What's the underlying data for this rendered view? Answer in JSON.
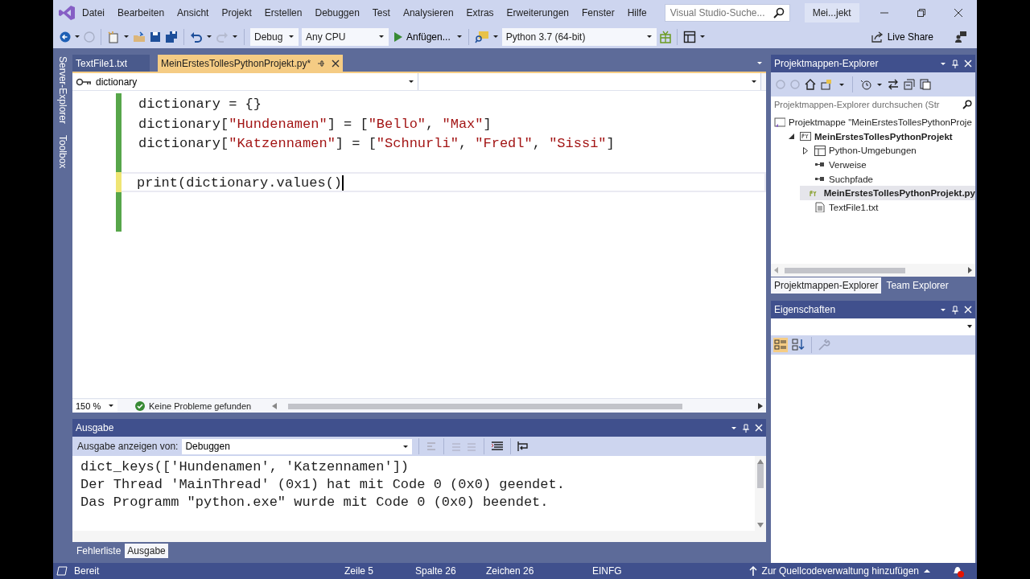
{
  "window": {
    "title": "Mei...jekt",
    "search_placeholder": "Visual Studio-Suche..."
  },
  "menu": [
    "Datei",
    "Bearbeiten",
    "Ansicht",
    "Projekt",
    "Erstellen",
    "Debuggen",
    "Test",
    "Analysieren",
    "Extras",
    "Erweiterungen",
    "Fenster",
    "Hilfe"
  ],
  "toolbar": {
    "configuration": "Debug",
    "platform": "Any CPU",
    "start": "Anfügen...",
    "environment": "Python 3.7 (64-bit)",
    "live_share": "Live Share"
  },
  "side_tabs": [
    "Server-Explorer",
    "Toolbox"
  ],
  "editor": {
    "tabs": [
      {
        "label": "TextFile1.txt",
        "selected": false
      },
      {
        "label": "MeinErstesTollesPythonProjekt.py*",
        "selected": true
      }
    ],
    "scope": "dictionary",
    "lines": [
      {
        "tokens": [
          {
            "kind": "plain",
            "text": "dictionary = {}"
          }
        ],
        "unsaved": false,
        "current": false
      },
      {
        "tokens": [
          {
            "kind": "plain",
            "text": "dictionary["
          },
          {
            "kind": "string",
            "text": "\"Hundenamen\""
          },
          {
            "kind": "plain",
            "text": "] = ["
          },
          {
            "kind": "string",
            "text": "\"Bello\""
          },
          {
            "kind": "plain",
            "text": ", "
          },
          {
            "kind": "string",
            "text": "\"Max\""
          },
          {
            "kind": "plain",
            "text": "]"
          }
        ],
        "unsaved": false,
        "current": false
      },
      {
        "tokens": [
          {
            "kind": "plain",
            "text": "dictionary["
          },
          {
            "kind": "string",
            "text": "\"Katzennamen\""
          },
          {
            "kind": "plain",
            "text": "] = ["
          },
          {
            "kind": "string",
            "text": "\"Schnurli\""
          },
          {
            "kind": "plain",
            "text": ", "
          },
          {
            "kind": "string",
            "text": "\"Fredl\""
          },
          {
            "kind": "plain",
            "text": ", "
          },
          {
            "kind": "string",
            "text": "\"Sissi\""
          },
          {
            "kind": "plain",
            "text": "]"
          }
        ],
        "unsaved": false,
        "current": false
      },
      {
        "unsaved": false,
        "current": false
      },
      {
        "tokens": [
          {
            "kind": "plain",
            "text": "print(dictionary.values()"
          }
        ],
        "unsaved": true,
        "current": true
      },
      {
        "unsaved": false,
        "current": false
      },
      {
        "unsaved": false,
        "current": false
      }
    ],
    "zoom": "150 %",
    "problems": "Keine Probleme gefunden"
  },
  "output": {
    "title": "Ausgabe",
    "source_label": "Ausgabe anzeigen von:",
    "source": "Debuggen",
    "lines": [
      "dict_keys(['Hundenamen', 'Katzennamen'])",
      "Der Thread 'MainThread' (0x1) hat mit Code 0 (0x0) geendet.",
      "Das Programm \"python.exe\" wurde mit Code 0 (0x0) beendet."
    ]
  },
  "bottom_tabs": [
    {
      "label": "Fehlerliste",
      "selected": false
    },
    {
      "label": "Ausgabe",
      "selected": true
    }
  ],
  "solution_explorer": {
    "title": "Projektmappen-Explorer",
    "search_placeholder": "Projektmappen-Explorer durchsuchen (Str",
    "tree": [
      {
        "label": "Projektmappe \"MeinErstesTollesPythonProje",
        "kind": "solution",
        "bold": false,
        "selected": false,
        "children": [
          {
            "label": "MeinErstesTollesPythonProjekt",
            "kind": "project",
            "bold": true,
            "selected": false,
            "expanded": true,
            "children": [
              {
                "label": "Python-Umgebungen",
                "kind": "environments",
                "bold": false,
                "selected": false,
                "expanded": false
              },
              {
                "label": "Verweise",
                "kind": "references",
                "bold": false,
                "selected": false
              },
              {
                "label": "Suchpfade",
                "kind": "references",
                "bold": false,
                "selected": false
              },
              {
                "label": "MeinErstesTollesPythonProjekt.py",
                "kind": "pyfile",
                "bold": true,
                "selected": true
              },
              {
                "label": "TextFile1.txt",
                "kind": "textfile",
                "bold": false,
                "selected": false
              }
            ]
          }
        ]
      }
    ]
  },
  "panel_tabs": [
    {
      "label": "Projektmappen-Explorer",
      "selected": true
    },
    {
      "label": "Team Explorer",
      "selected": false
    }
  ],
  "properties": {
    "title": "Eigenschaften"
  },
  "status_bar": {
    "state": "Bereit",
    "line": "Zeile 5",
    "column": "Spalte 26",
    "character": "Zeichen 26",
    "mode": "EINFG",
    "source_control": "Zur Quellcodeverwaltung hinzufügen"
  }
}
